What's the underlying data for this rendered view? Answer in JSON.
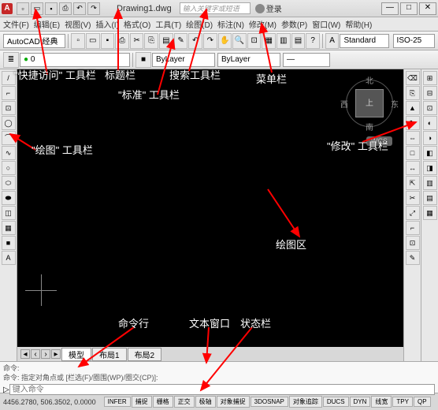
{
  "titlebar": {
    "logo": "A",
    "title": "Drawing1.dwg",
    "search_placeholder": "输入关键字或短语",
    "user_label": "登录",
    "qat_icons": [
      "new",
      "open",
      "save",
      "print",
      "undo",
      "redo"
    ],
    "min": "—",
    "max": "□",
    "close": "✕"
  },
  "menubar": {
    "items": [
      "文件(F)",
      "编辑(E)",
      "视图(V)",
      "插入(I)",
      "格式(O)",
      "工具(T)",
      "绘图(D)",
      "标注(N)",
      "修改(M)",
      "参数(P)",
      "窗口(W)",
      "帮助(H)"
    ]
  },
  "toolbar1": {
    "workspace": "AutoCAD 经典",
    "buttons": [
      "new",
      "open",
      "save",
      "print",
      "cut",
      "copy",
      "paste",
      "match",
      "undo",
      "redo",
      "pan",
      "zoom",
      "zoomext",
      "prop",
      "sheet",
      "calc",
      "help"
    ]
  },
  "toolbar2": {
    "layer_icon": "≣",
    "layer": "0",
    "style_icon": "A",
    "style": "Standard",
    "dimstyle": "ISO-25",
    "bylayer": "ByLayer",
    "bylayer2": "ByLayer",
    "lineweight": "—"
  },
  "draw_toolbar": [
    "/",
    "⌐",
    "⊡",
    "◯",
    "⌒",
    "∿",
    "○",
    "⬭",
    "⬬",
    "◫",
    "▦",
    "■",
    "A"
  ],
  "modify_toolbar": [
    "⌫",
    "⎘",
    "▲",
    "↻",
    "⇔",
    "□",
    "↔",
    "⇱",
    "✂",
    "⤢",
    "⌐",
    "⊡",
    "✎"
  ],
  "right_toolbar": [
    "⊞",
    "⊟",
    "⊡",
    "◐",
    "◑",
    "◧",
    "◨",
    "▥",
    "▤",
    "▦"
  ],
  "viewcube": {
    "top": "上",
    "n": "北",
    "s": "南",
    "e": "东",
    "w": "西"
  },
  "wcs": "WCS",
  "tabs": {
    "model": "模型",
    "layout1": "布局1",
    "layout2": "布局2"
  },
  "cmd": {
    "hist1": "命令:",
    "hist2": "命令: 指定对角点或 [栏选(F)/圈围(WP)/圈交(CP)]:",
    "prompt": "▷",
    "placeholder": "键入命令"
  },
  "statusbar": {
    "coord": "4456.2780, 506.3502, 0.0000",
    "buttons": [
      "INFER",
      "捕捉",
      "栅格",
      "正交",
      "极轴",
      "对象捕捉",
      "3DOSNAP",
      "对象追踪",
      "DUCS",
      "DYN",
      "线宽",
      "TPY",
      "QP"
    ]
  },
  "annotations": {
    "qat": "\"快捷访问\" 工具栏",
    "title": "标题栏",
    "search": "搜索工具栏",
    "menu": "菜单栏",
    "std": "\"标准\" 工具栏",
    "draw": "\"绘图\" 工具栏",
    "modify": "\"修改\" 工具栏",
    "drawarea": "绘图区",
    "textwin": "文本窗口",
    "cmdline": "命令行",
    "status": "状态栏"
  }
}
